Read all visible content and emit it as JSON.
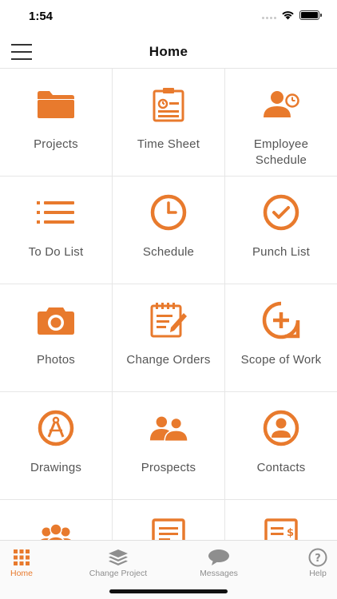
{
  "status_bar": {
    "time": "1:54"
  },
  "nav": {
    "title": "Home"
  },
  "colors": {
    "accent": "#e87a2d",
    "tab_inactive": "#8e8e8e"
  },
  "tiles": [
    {
      "label": "Projects",
      "icon": "folder-icon"
    },
    {
      "label": "Time Sheet",
      "icon": "timesheet-icon"
    },
    {
      "label": "Employee Schedule",
      "icon": "employee-schedule-icon"
    },
    {
      "label": "To Do List",
      "icon": "list-icon"
    },
    {
      "label": "Schedule",
      "icon": "clock-icon"
    },
    {
      "label": "Punch List",
      "icon": "check-circle-icon"
    },
    {
      "label": "Photos",
      "icon": "camera-icon"
    },
    {
      "label": "Change Orders",
      "icon": "notepad-pencil-icon"
    },
    {
      "label": "Scope of Work",
      "icon": "plus-bubble-icon"
    },
    {
      "label": "Drawings",
      "icon": "compass-icon"
    },
    {
      "label": "Prospects",
      "icon": "people-icon"
    },
    {
      "label": "Contacts",
      "icon": "contact-icon"
    },
    {
      "label": "",
      "icon": "group-icon"
    },
    {
      "label": "",
      "icon": "document-icon"
    },
    {
      "label": "",
      "icon": "invoice-icon"
    }
  ],
  "tabs": [
    {
      "label": "Home",
      "icon": "grid-icon",
      "active": true
    },
    {
      "label": "Change Project",
      "icon": "layers-icon",
      "active": false
    },
    {
      "label": "Messages",
      "icon": "chat-bubble-icon",
      "active": false
    },
    {
      "label": "Help",
      "icon": "help-icon",
      "active": false
    }
  ]
}
